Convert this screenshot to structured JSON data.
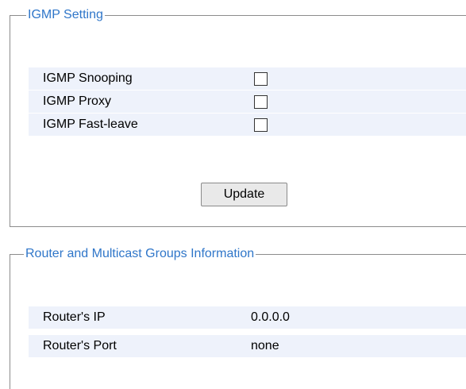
{
  "igmp_setting": {
    "legend": "IGMP Setting",
    "rows": [
      {
        "label": "IGMP Snooping",
        "checked": false
      },
      {
        "label": "IGMP Proxy",
        "checked": false
      },
      {
        "label": "IGMP Fast-leave",
        "checked": false
      }
    ],
    "update_label": "Update"
  },
  "router_info": {
    "legend": "Router and Multicast Groups Information",
    "rows": [
      {
        "label": "Router's IP",
        "value": "0.0.0.0"
      },
      {
        "label": "Router's Port",
        "value": "none"
      }
    ]
  },
  "colors": {
    "legend_text": "#2f76c9",
    "row_background": "#eef2fb",
    "border": "#8c8c8c"
  }
}
